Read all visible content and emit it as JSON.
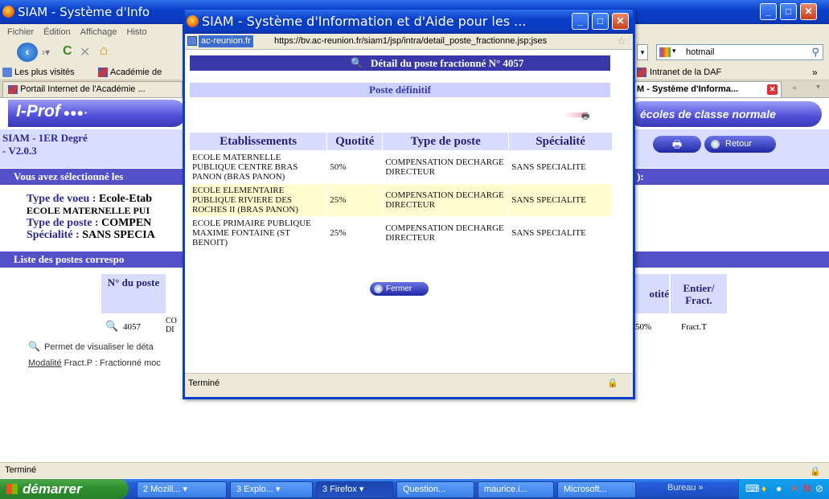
{
  "main_window": {
    "title": "SIAM - Système d'Info",
    "menu": [
      "Fichier",
      "Édition",
      "Affichage",
      "Histo"
    ],
    "search_engine": "hotmail",
    "bookmarks": [
      "Les plus visités",
      "Académie de",
      "Intranet de la DAF"
    ],
    "tabs": [
      "Portail Internet de l'Académie ...",
      "M - Système d'Informa..."
    ],
    "banner_logo": "I-Prof",
    "banner_right": "écoles de classe normale",
    "siam_line1": "SIAM - 1ER Degré",
    "siam_line2": "- V2.0.3",
    "retour_label": "Retour",
    "selected_strip": "Vous avez sélectionné les",
    "selected_strip_right": "):",
    "type_voeu_label": "Type de voeu :",
    "type_voeu_value": "Ecole-Etab",
    "ecole_line": "ECOLE MATERNELLE PUI",
    "type_poste_label": "Type de poste :",
    "type_poste_value": "COMPEN",
    "specialite_label": "Spécialité :",
    "specialite_value": "SANS SPECIA",
    "liste_strip": "Liste des postes correspo",
    "table_header_no": "N° du poste",
    "table_header_quotite": "otité",
    "table_header_entier": "Entier/ Fract.",
    "row_no": "4057",
    "row_frag": "CO DI",
    "row_quotite": "50%",
    "row_entier": "Fract.T",
    "help_text": "Permet de visualiser le déta",
    "modalite_label": "Modalité",
    "modalite_text": "Fract.P : Fractionné moc",
    "status": "Terminé"
  },
  "popup": {
    "title": "SIAM - Système d'Information et d'Aide pour les ...",
    "url_domain": "ac-reunion.fr",
    "url": "https://bv.ac-reunion.fr/siam1/jsp/intra/detail_poste_fractionne.jsp;jses",
    "header_title": "Détail du poste fractionné N° 4057",
    "subheader": "Poste définitif",
    "columns": [
      "Etablissements",
      "Quotité",
      "Type de poste",
      "Spécialité"
    ],
    "rows": [
      {
        "etablissement": "ECOLE MATERNELLE PUBLIQUE CENTRE BRAS PANON (BRAS PANON)",
        "quotite": "50%",
        "type": "COMPENSATION DECHARGE DIRECTEUR",
        "specialite": "SANS SPECIALITE"
      },
      {
        "etablissement": "ECOLE ELEMENTAIRE PUBLIQUE RIVIERE DES ROCHES II (BRAS PANON)",
        "quotite": "25%",
        "type": "COMPENSATION DECHARGE DIRECTEUR",
        "specialite": "SANS SPECIALITE"
      },
      {
        "etablissement": "ECOLE PRIMAIRE PUBLIQUE MAXIME FONTAINE (ST BENOIT)",
        "quotite": "25%",
        "type": "COMPENSATION DECHARGE DIRECTEUR",
        "specialite": "SANS SPECIALITE"
      }
    ],
    "fermer_label": "Fermer",
    "status": "Terminé"
  },
  "taskbar": {
    "start": "démarrer",
    "buttons": [
      "2 Mozill...",
      "3 Explo...",
      "3 Firefox",
      "Question...",
      "maurice.i...",
      "Microsoft...",
      "Bureau"
    ]
  },
  "colors": {
    "accent_dark": "#3a37a8",
    "accent_light": "#d8dcff",
    "highlight_row": "#fffdd0"
  }
}
